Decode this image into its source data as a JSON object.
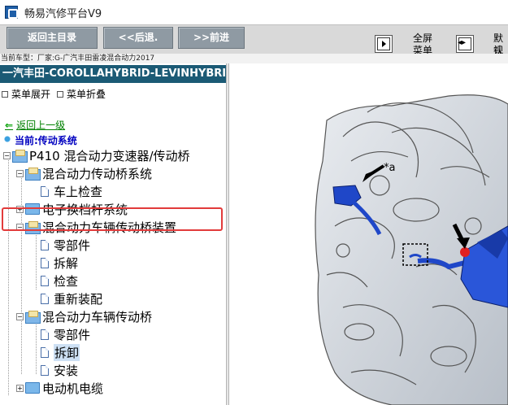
{
  "window": {
    "title": "畅易汽修平台V9"
  },
  "toolbar": {
    "home_label": "返回主目录",
    "back_label": "<<后退.",
    "forward_label": ">>前进",
    "fullscreen_label_1": "全屏",
    "fullscreen_label_2": "菜单",
    "default_label_1": "默认",
    "default_label_2": "视图"
  },
  "car_model": "当前车型：厂家:G-广汽丰田雷凌混合动力2017",
  "left": {
    "model_bar": "一汽丰田-COROLLAHYBRID-LEVINHYBRID",
    "menu_expand": "菜单展开",
    "menu_collapse": "菜单折叠",
    "back_link": "返回上一级",
    "current": "当前:传动系统",
    "tree": [
      {
        "label": "P410 混合动力变速器/传动桥",
        "type": "folder-open",
        "toggle": "−"
      },
      {
        "label": "混合动力传动桥系统",
        "type": "folder-open",
        "toggle": "−"
      },
      {
        "label": "车上检查",
        "type": "doc"
      },
      {
        "label": "电子换档杆系统",
        "type": "folder",
        "toggle": "+"
      },
      {
        "label": "混合动力车辆传动桥装置",
        "type": "folder-open",
        "toggle": "−"
      },
      {
        "label": "零部件",
        "type": "doc"
      },
      {
        "label": "拆解",
        "type": "doc"
      },
      {
        "label": "检查",
        "type": "doc"
      },
      {
        "label": "重新装配",
        "type": "doc"
      },
      {
        "label": "混合动力车辆传动桥",
        "type": "folder-open",
        "toggle": "−"
      },
      {
        "label": "零部件",
        "type": "doc"
      },
      {
        "label": "拆卸",
        "type": "doc",
        "selected": true
      },
      {
        "label": "安装",
        "type": "doc"
      },
      {
        "label": "电动机电缆",
        "type": "folder",
        "toggle": "+"
      }
    ]
  },
  "diagram": {
    "callout": "*a"
  },
  "colors": {
    "model_bar": "#1b5a75",
    "toolbar_button": "#8f9aa3",
    "highlight": "#e23b3b",
    "part_blue": "#1f47c8"
  }
}
